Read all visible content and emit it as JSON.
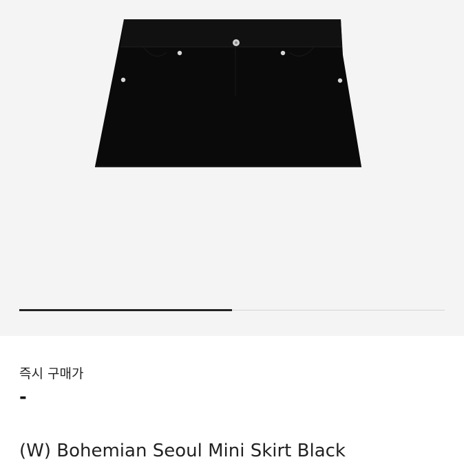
{
  "gallery": {
    "image_subject": "black mini skirt",
    "progress_fraction": 0.5
  },
  "product": {
    "price_label": "즉시 구매가",
    "price_value": "-",
    "title": "(W) Bohemian Seoul Mini Skirt Black"
  },
  "colors": {
    "image_background": "#f4f4f4",
    "skirt": "#0a0a0a",
    "text": "#222222",
    "progress_track": "#d3d3d3",
    "progress_fill": "#222222"
  }
}
